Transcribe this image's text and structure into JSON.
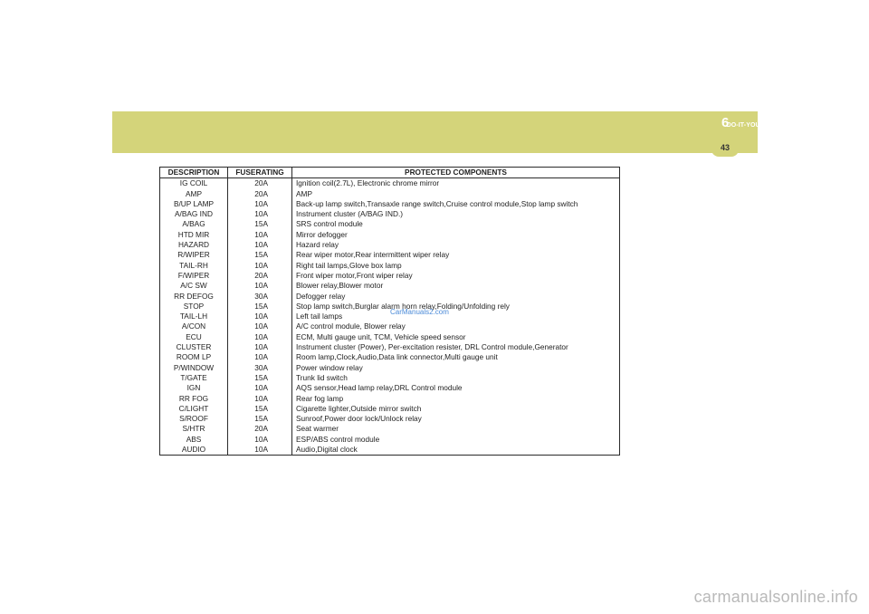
{
  "header": {
    "section_title": "DO-IT-YOURSELF MAINTENANCE",
    "chapter_number": "6",
    "page_number": "43",
    "band_color": "#d4d47a"
  },
  "fuse_table": {
    "columns": [
      "DESCRIPTION",
      "FUSERATING",
      "PROTECTED  COMPONENTS"
    ],
    "rows": [
      [
        "IG  COIL",
        "20A",
        "Ignition coil(2.7L), Electronic chrome mirror"
      ],
      [
        "AMP",
        "20A",
        "AMP"
      ],
      [
        "B/UP LAMP",
        "10A",
        "Back-up lamp switch,Transaxle range switch,Cruise control module,Stop lamp switch"
      ],
      [
        "A/BAG IND",
        "10A",
        "Instrument cluster (A/BAG IND.)"
      ],
      [
        "A/BAG",
        "15A",
        "SRS control module"
      ],
      [
        "HTD MIR",
        "10A",
        "Mirror defogger"
      ],
      [
        "HAZARD",
        "10A",
        "Hazard relay"
      ],
      [
        "R/WIPER",
        "15A",
        "Rear wiper motor,Rear intermittent wiper relay"
      ],
      [
        "TAIL-RH",
        "10A",
        "Right tail lamps,Glove box lamp"
      ],
      [
        "F/WIPER",
        "20A",
        "Front wiper motor,Front wiper relay"
      ],
      [
        "A/C SW",
        "10A",
        "Blower relay,Blower motor"
      ],
      [
        "RR  DEFOG",
        "30A",
        "Defogger relay"
      ],
      [
        "STOP",
        "15A",
        "Stop lamp switch,Burglar alarm horn relay,Folding/Unfolding rely"
      ],
      [
        "TAIL-LH",
        "10A",
        "Left tail lamps"
      ],
      [
        "A/CON",
        "10A",
        "A/C control module, Blower relay"
      ],
      [
        "ECU",
        "10A",
        "ECM, Multi gauge unit, TCM, Vehicle speed sensor"
      ],
      [
        "CLUSTER",
        "10A",
        "Instrument cluster (Power), Per-excitation resister, DRL Control module,Generator"
      ],
      [
        "ROOM  LP",
        "10A",
        "Room lamp,Clock,Audio,Data link connector,Multi gauge unit"
      ],
      [
        "P/WINDOW",
        "30A",
        "Power window relay"
      ],
      [
        "T/GATE",
        "15A",
        "Trunk lid switch"
      ],
      [
        "IGN",
        "10A",
        "AQS sensor,Head lamp relay,DRL Control module"
      ],
      [
        "RR  FOG",
        "10A",
        "Rear fog lamp"
      ],
      [
        "C/LIGHT",
        "15A",
        "Cigarette lighter,Outside mirror switch"
      ],
      [
        "S/ROOF",
        "15A",
        "Sunroof,Power door lock/Unlock relay"
      ],
      [
        "S/HTR",
        "20A",
        "Seat warmer"
      ],
      [
        "ABS",
        "10A",
        "ESP/ABS control module"
      ],
      [
        "AUDIO",
        "10A",
        "Audio,Digital clock"
      ]
    ]
  },
  "watermarks": {
    "middle": "CarManuals2.com",
    "bottom": "carmanualsonline.info"
  }
}
